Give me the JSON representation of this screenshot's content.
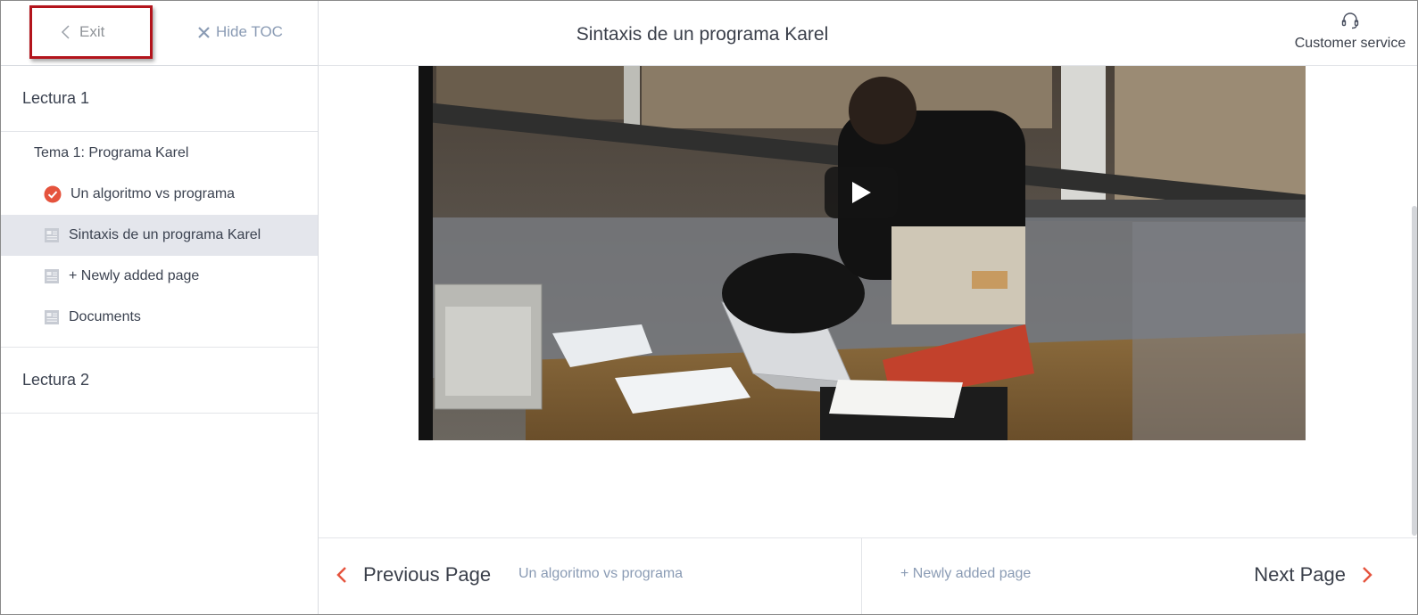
{
  "sidebar": {
    "exit_label": "Exit",
    "hide_toc_label": "Hide TOC",
    "chapters": [
      {
        "title": "Lectura 1",
        "topic": "Tema 1: Programa Karel",
        "items": [
          {
            "label": "Un algoritmo vs programa",
            "icon": "check-circle-icon",
            "state": "completed"
          },
          {
            "label": "Sintaxis de un programa Karel",
            "icon": "page-icon",
            "state": "active"
          },
          {
            "label": "+ Newly added page",
            "icon": "page-icon",
            "state": "normal"
          },
          {
            "label": "Documents",
            "icon": "page-icon",
            "state": "normal"
          }
        ]
      },
      {
        "title": "Lectura 2"
      }
    ]
  },
  "header": {
    "title": "Sintaxis de un programa Karel",
    "customer_service_label": "Customer service"
  },
  "video": {
    "play_icon": "play-icon"
  },
  "footer": {
    "previous_label": "Previous Page",
    "previous_title": "Un algoritmo vs programa",
    "next_title": "+ Newly added page",
    "next_label": "Next Page"
  },
  "colors": {
    "accent_red": "#e5533d",
    "highlight_border": "#b3141c",
    "active_row": "#e4e6ec",
    "muted_link": "#8a9bb4",
    "text_dark": "#3a3f4a"
  }
}
